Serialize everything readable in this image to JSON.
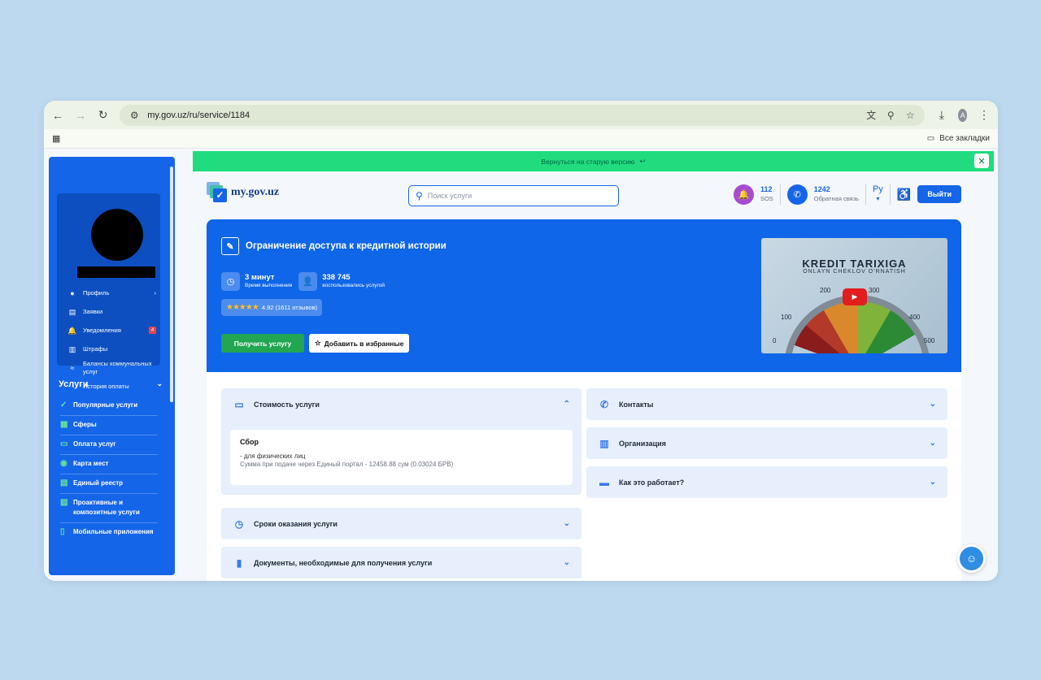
{
  "browser": {
    "url": "my.gov.uz/ru/service/1184",
    "avatar_letter": "A",
    "bookmarks_label": "Все закладки"
  },
  "banner": {
    "text": "Вернуться на старую версию",
    "close": "✕"
  },
  "header": {
    "logo_text": "my.gov.uz",
    "search_placeholder": "Поиск услуги",
    "sos_number": "112",
    "sos_label": "SOS",
    "phone_number": "1242",
    "phone_label": "Обратная связь",
    "lang": "Ру",
    "logout": "Выйти"
  },
  "sidebar": {
    "profile_menu": [
      {
        "label": "Профиль",
        "icon": "user-icon"
      },
      {
        "label": "Заявки",
        "icon": "document-icon"
      },
      {
        "label": "Уведомления",
        "icon": "bell-icon",
        "badge": "4"
      },
      {
        "label": "Штрафы",
        "icon": "fine-icon"
      },
      {
        "label": "Балансы коммунальных услуг",
        "icon": "utility-icon"
      },
      {
        "label": "История оплаты",
        "icon": "wallet-icon"
      }
    ],
    "services_title": "Услуги",
    "services": [
      {
        "label": "Популярные услуги",
        "icon": "check-circle-icon"
      },
      {
        "label": "Сферы",
        "icon": "grid-icon"
      },
      {
        "label": "Оплата услуг",
        "icon": "card-icon"
      },
      {
        "label": "Карта мест",
        "icon": "pin-icon"
      },
      {
        "label": "Единый реестр",
        "icon": "registry-icon"
      },
      {
        "label": "Проактивные и композитные услуги",
        "icon": "composite-icon"
      },
      {
        "label": "Мобильные приложения",
        "icon": "mobile-icon"
      }
    ]
  },
  "hero": {
    "title": "Ограничение доступа к кредитной истории",
    "time_value": "3 минут",
    "time_label": "Время выполнения",
    "users_value": "338 745",
    "users_label": "воспользовались услугой",
    "rating_text": "4.92 (1611 отзывов)",
    "rating_stars": 5,
    "get_button": "Получить услугу",
    "fav_button": "Добавить в избранные",
    "video_title": "KREDIT TARIXIGA",
    "video_subtitle": "ONLAYN CHEKLOV O'RNATISH",
    "gauge_ticks": [
      "0",
      "100",
      "200",
      "300",
      "400",
      "500"
    ]
  },
  "accordions": {
    "cost": {
      "title": "Стоимость услуги",
      "fee_title": "Сбор",
      "fee_line1": "- для физических лиц",
      "fee_line2": "Сумма при подаче через Единый портал - 12458.88 сум (0.03024 БРВ)"
    },
    "terms": "Сроки оказания услуги",
    "documents": "Документы, необходимые для получения услуги",
    "contacts": "Контакты",
    "organization": "Организация",
    "how": "Как это работает?"
  }
}
